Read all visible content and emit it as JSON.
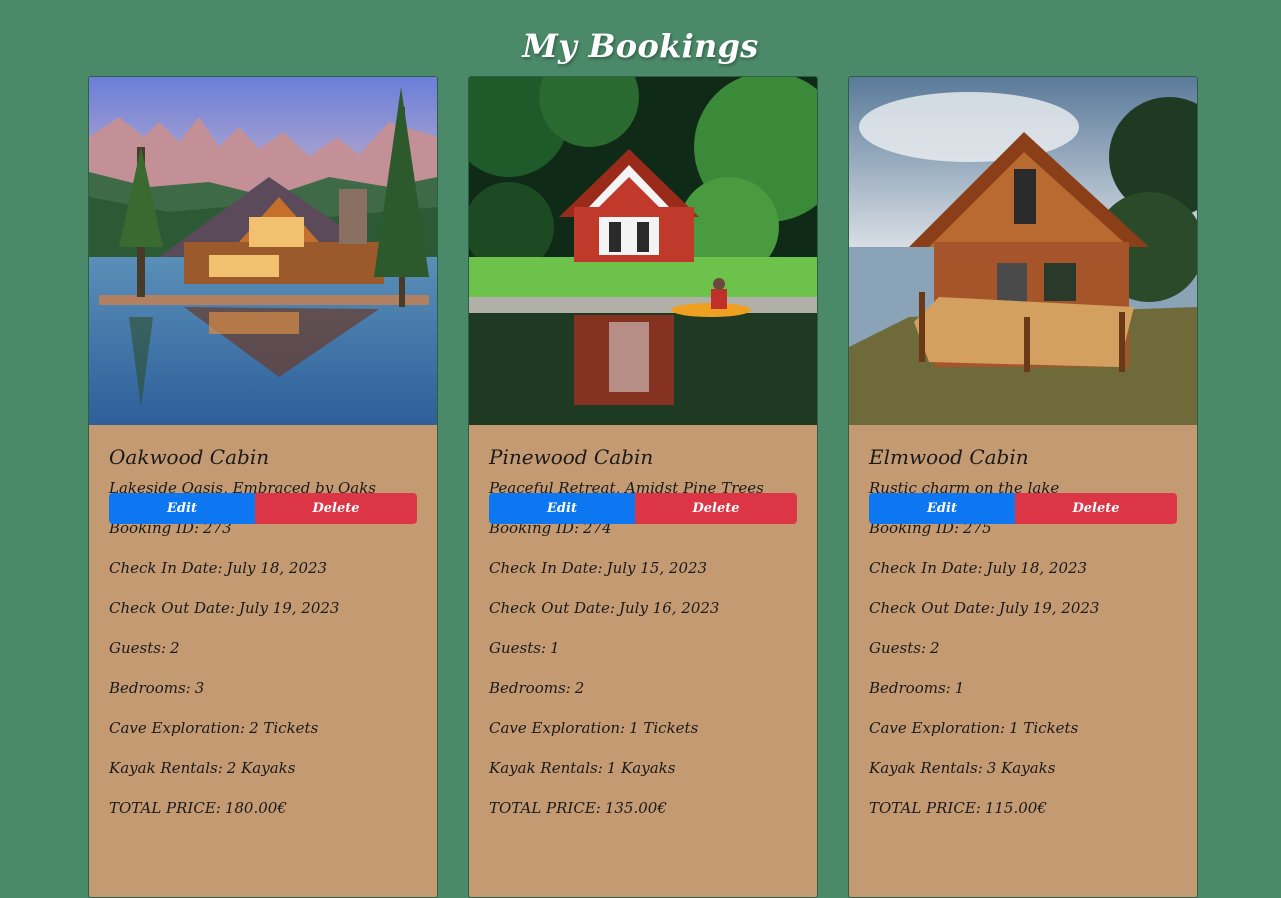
{
  "page": {
    "title": "My Bookings"
  },
  "labels": {
    "booking_id": "Booking ID:",
    "check_in": "Check In Date:",
    "check_out": "Check Out Date:",
    "guests": "Guests:",
    "bedrooms": "Bedrooms:",
    "cave": "Cave Exploration:",
    "kayak": "Kayak Rentals:",
    "total": "TOTAL PRICE:"
  },
  "buttons": {
    "edit": "Edit",
    "delete": "Delete"
  },
  "colors": {
    "background": "#4b8a69",
    "card": "#c49a72",
    "edit": "#0d77f2",
    "delete": "#dc3545"
  },
  "bookings": [
    {
      "name": "Oakwood Cabin",
      "tagline": "Lakeside Oasis, Embraced by Oaks",
      "booking_id": "273",
      "check_in": "July 18, 2023",
      "check_out": "July 19, 2023",
      "guests": "2",
      "bedrooms": "3",
      "cave": "2 Tickets",
      "kayak": "2 Kayaks",
      "total": "180.00€"
    },
    {
      "name": "Pinewood Cabin",
      "tagline": "Peaceful Retreat, Amidst Pine Trees",
      "booking_id": "274",
      "check_in": "July 15, 2023",
      "check_out": "July 16, 2023",
      "guests": "1",
      "bedrooms": "2",
      "cave": "1 Tickets",
      "kayak": "1 Kayaks",
      "total": "135.00€"
    },
    {
      "name": "Elmwood Cabin",
      "tagline": "Rustic charm on the lake",
      "booking_id": "275",
      "check_in": "July 18, 2023",
      "check_out": "July 19, 2023",
      "guests": "2",
      "bedrooms": "1",
      "cave": "1 Tickets",
      "kayak": "3 Kayaks",
      "total": "115.00€"
    }
  ]
}
